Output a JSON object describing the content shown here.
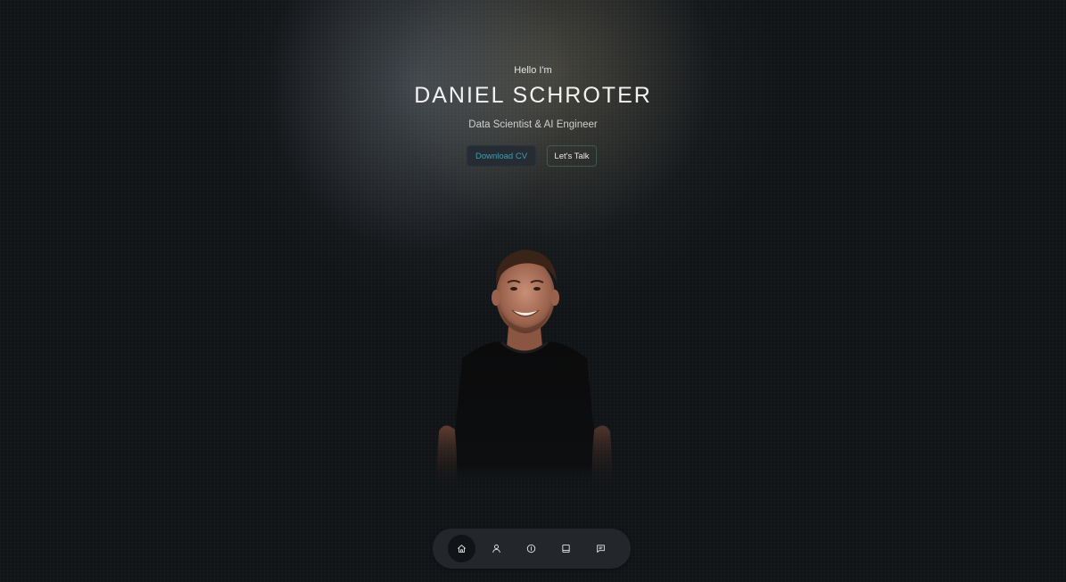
{
  "hero": {
    "greeting": "Hello I'm",
    "name": "DANIEL SCHROTER",
    "role": "Data Scientist & AI Engineer",
    "download_cv_label": "Download CV",
    "lets_talk_label": "Let's Talk"
  },
  "nav": {
    "items": [
      {
        "icon": "home-icon",
        "active": true
      },
      {
        "icon": "user-icon",
        "active": false
      },
      {
        "icon": "info-icon",
        "active": false
      },
      {
        "icon": "book-icon",
        "active": false
      },
      {
        "icon": "message-icon",
        "active": false
      }
    ]
  },
  "colors": {
    "background": "#111417",
    "accent": "#3e9fb1",
    "button_border": "#3b5a55",
    "dock": "#23272b"
  }
}
